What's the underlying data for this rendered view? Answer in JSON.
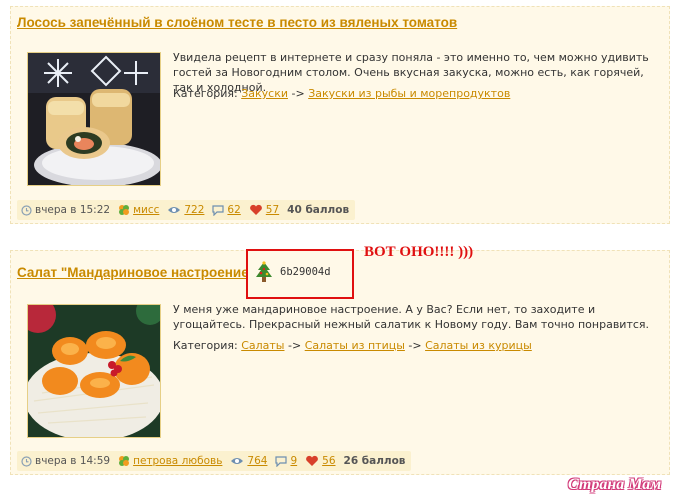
{
  "posts": [
    {
      "title": "Лосось запечённый в слоёном тесте в песто из вяленых томатов",
      "description": "Увидела рецепт в интернете и сразу поняла - это именно то, чем можно удивить гостей за Новогодним столом. Очень вкусная закуска, можно есть, как горячей, так и холодной.",
      "category_label": "Категория:",
      "categories": [
        "Закуски",
        "Закуски из рыбы и морепродуктов"
      ],
      "separator": "->",
      "time": "вчера в 15:22",
      "author": "мисс",
      "views": "722",
      "comments": "62",
      "likes": "57",
      "score": "40 баллов"
    },
    {
      "title": "Салат \"Мандариновое настроение\"",
      "description": "У меня уже мандариновое настроение. А у Вас? Если нет, то заходите и угощайтесь. Прекрасный нежный салатик к Новому году. Вам точно понравится.",
      "category_label": "Категория:",
      "categories": [
        "Салаты",
        "Салаты из птицы",
        "Салаты из курицы"
      ],
      "separator": "->",
      "time": "вчера в 14:59",
      "author": "петрова любовь",
      "views": "764",
      "comments": "9",
      "likes": "56",
      "score": "26 баллов"
    }
  ],
  "highlight": {
    "code": "6b29004d",
    "icon": "christmas-tree-icon",
    "annotation": "ВОТ ОНО!!!! )))",
    "color": "#e01010"
  },
  "watermark": "Страна Мам",
  "colors": {
    "link": "#c98a00",
    "card_bg": "#fff9e8",
    "meta_bg": "#fbf1cf"
  }
}
